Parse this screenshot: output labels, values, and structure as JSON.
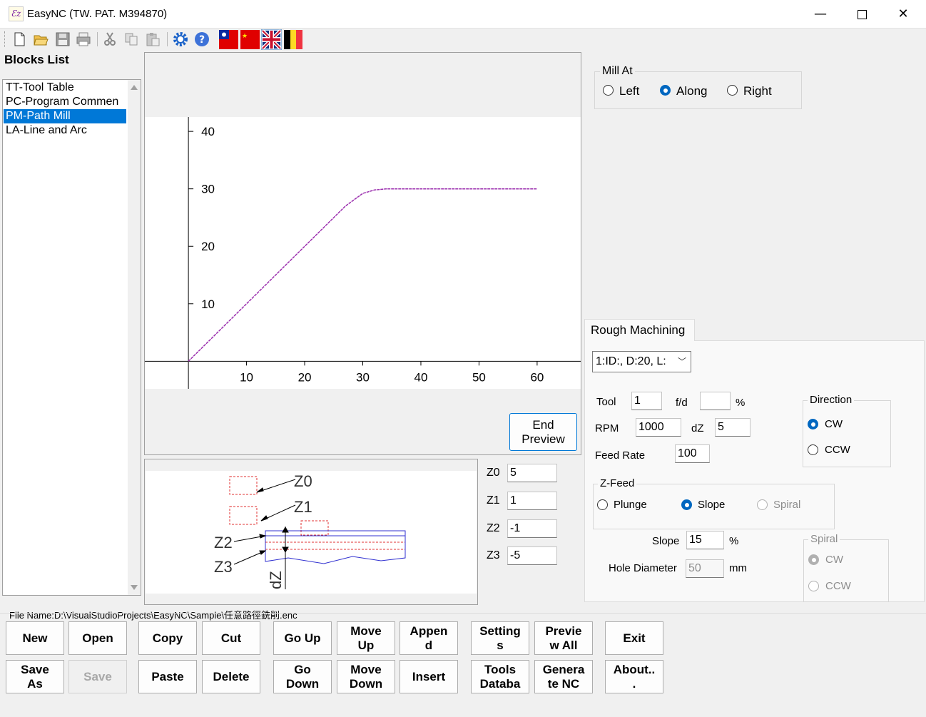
{
  "window": {
    "title": "EasyNC  (TW. PAT. M394870)",
    "app_icon_text": "Ɛz"
  },
  "toolbar": {
    "icons": [
      "new-file-icon",
      "open-folder-icon",
      "save-disk-icon",
      "print-icon",
      "cut-icon",
      "copy-icon",
      "paste-icon",
      "settings-gear-icon",
      "help-icon",
      "taiwan-flag-icon",
      "china-flag-icon",
      "uk-flag-icon",
      "belgium-flag-icon"
    ]
  },
  "blocks": {
    "title": "Blocks List",
    "items": [
      "TT-Tool Table",
      "PC-Program Commen",
      "PM-Path Mill",
      "LA-Line and Arc"
    ],
    "selected_index": 2
  },
  "chart_data": {
    "type": "line",
    "x": [
      0,
      27,
      30,
      32,
      34,
      36,
      60
    ],
    "y": [
      0,
      27,
      29.2,
      29.8,
      30,
      30,
      30
    ],
    "xticks": [
      "10",
      "20",
      "30",
      "40",
      "50",
      "60"
    ],
    "yticks": [
      "10",
      "20",
      "30",
      "40"
    ],
    "xlim": [
      -7.5,
      67.5
    ],
    "ylim": [
      -4.8,
      42.5
    ],
    "color": "#9b2fae"
  },
  "preview": {
    "end_button": "End\nPreview"
  },
  "diagram": {
    "labels": {
      "z0": "Z0",
      "z1": "Z1",
      "z2": "Z2",
      "z3": "Z3",
      "dz": "dZ"
    }
  },
  "z_fields": [
    {
      "label": "Z0",
      "value": "5"
    },
    {
      "label": "Z1",
      "value": "1"
    },
    {
      "label": "Z2",
      "value": "-1"
    },
    {
      "label": "Z3",
      "value": "-5"
    }
  ],
  "mill_at": {
    "title": "Mill At",
    "options": [
      "Left",
      "Along",
      "Right"
    ],
    "selected": "Along"
  },
  "rough": {
    "tab_label": "Rough Machining",
    "tool_select": "1:ID:, D:20, L:",
    "tool_label": "Tool",
    "tool_value": "1",
    "fd_label": "f/d",
    "fd_value": "",
    "fd_unit": "%",
    "rpm_label": "RPM",
    "rpm_value": "1000",
    "dz_label": "dZ",
    "dz_value": "5",
    "feed_label": "Feed Rate",
    "feed_value": "100",
    "direction": {
      "title": "Direction",
      "options": [
        "CW",
        "CCW"
      ],
      "selected": "CW"
    },
    "zfeed": {
      "title": "Z-Feed",
      "options": [
        "Plunge",
        "Slope",
        "Spiral"
      ],
      "selected": "Slope"
    },
    "slope_label": "Slope",
    "slope_value": "15",
    "slope_unit": "%",
    "hole_label": "Hole Diameter",
    "hole_value": "50",
    "hole_unit": "mm",
    "spiral": {
      "title": "Spiral",
      "options": [
        "CW",
        "CCW"
      ],
      "selected": "CW"
    }
  },
  "file_name": "File Name:D:\\VisualStudioProjects\\EasyNC\\Sample\\任意路徑銑削.enc",
  "buttons": {
    "new": "New",
    "open": "Open",
    "copy": "Copy",
    "cut": "Cut",
    "go_up": "Go Up",
    "move_up": "Move\nUp",
    "append": "Appen\nd",
    "settings": "Setting\ns",
    "preview_all": "Previe\nw All",
    "exit": "Exit",
    "save_as": "Save\nAs",
    "save": "Save",
    "paste": "Paste",
    "delete": "Delete",
    "go_down": "Go\nDown",
    "move_down": "Move\nDown",
    "insert": "Insert",
    "tools_db": "Tools\nDataba",
    "generate_nc": "Genera\nte NC",
    "about": "About..\n."
  }
}
